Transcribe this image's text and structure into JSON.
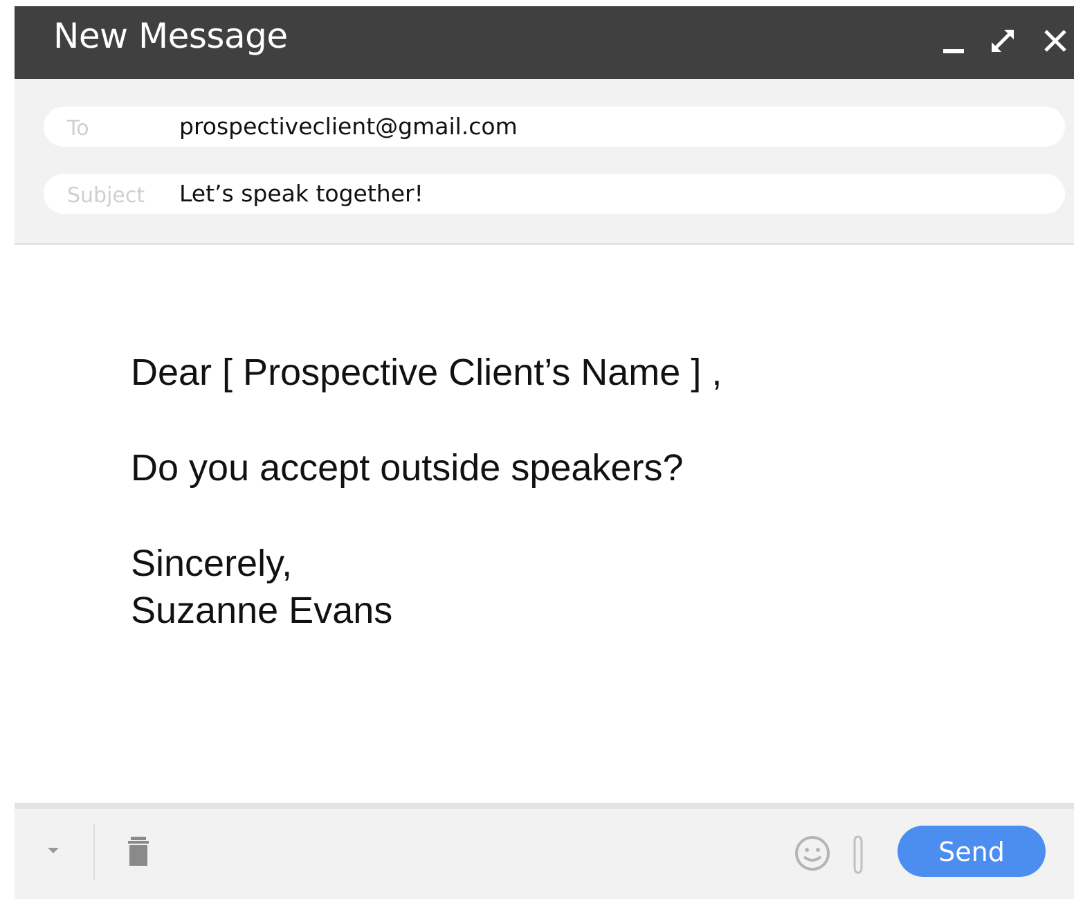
{
  "window": {
    "title": "New Message",
    "controls": {
      "minimize_icon": "minimize-icon",
      "expand_icon": "expand-icon",
      "close_icon": "close-icon"
    }
  },
  "fields": {
    "to": {
      "label": "To",
      "value": "prospectiveclient@gmail.com"
    },
    "subject": {
      "label": "Subject",
      "value": "Let’s speak together!"
    }
  },
  "message": {
    "greeting": "Dear [ Prospective Client’s Name ] ,",
    "question": "Do you accept outside speakers?",
    "closing": "Sincerely,",
    "signature": "Suzanne Evans"
  },
  "footer": {
    "send_label": "Send",
    "icons": [
      "more-options-icon",
      "trash-icon",
      "emoji-icon",
      "attachment-icon"
    ]
  },
  "colors": {
    "titlebar": "#404040",
    "header_bg": "#f2f2f2",
    "send_button": "#4c8ef0"
  }
}
